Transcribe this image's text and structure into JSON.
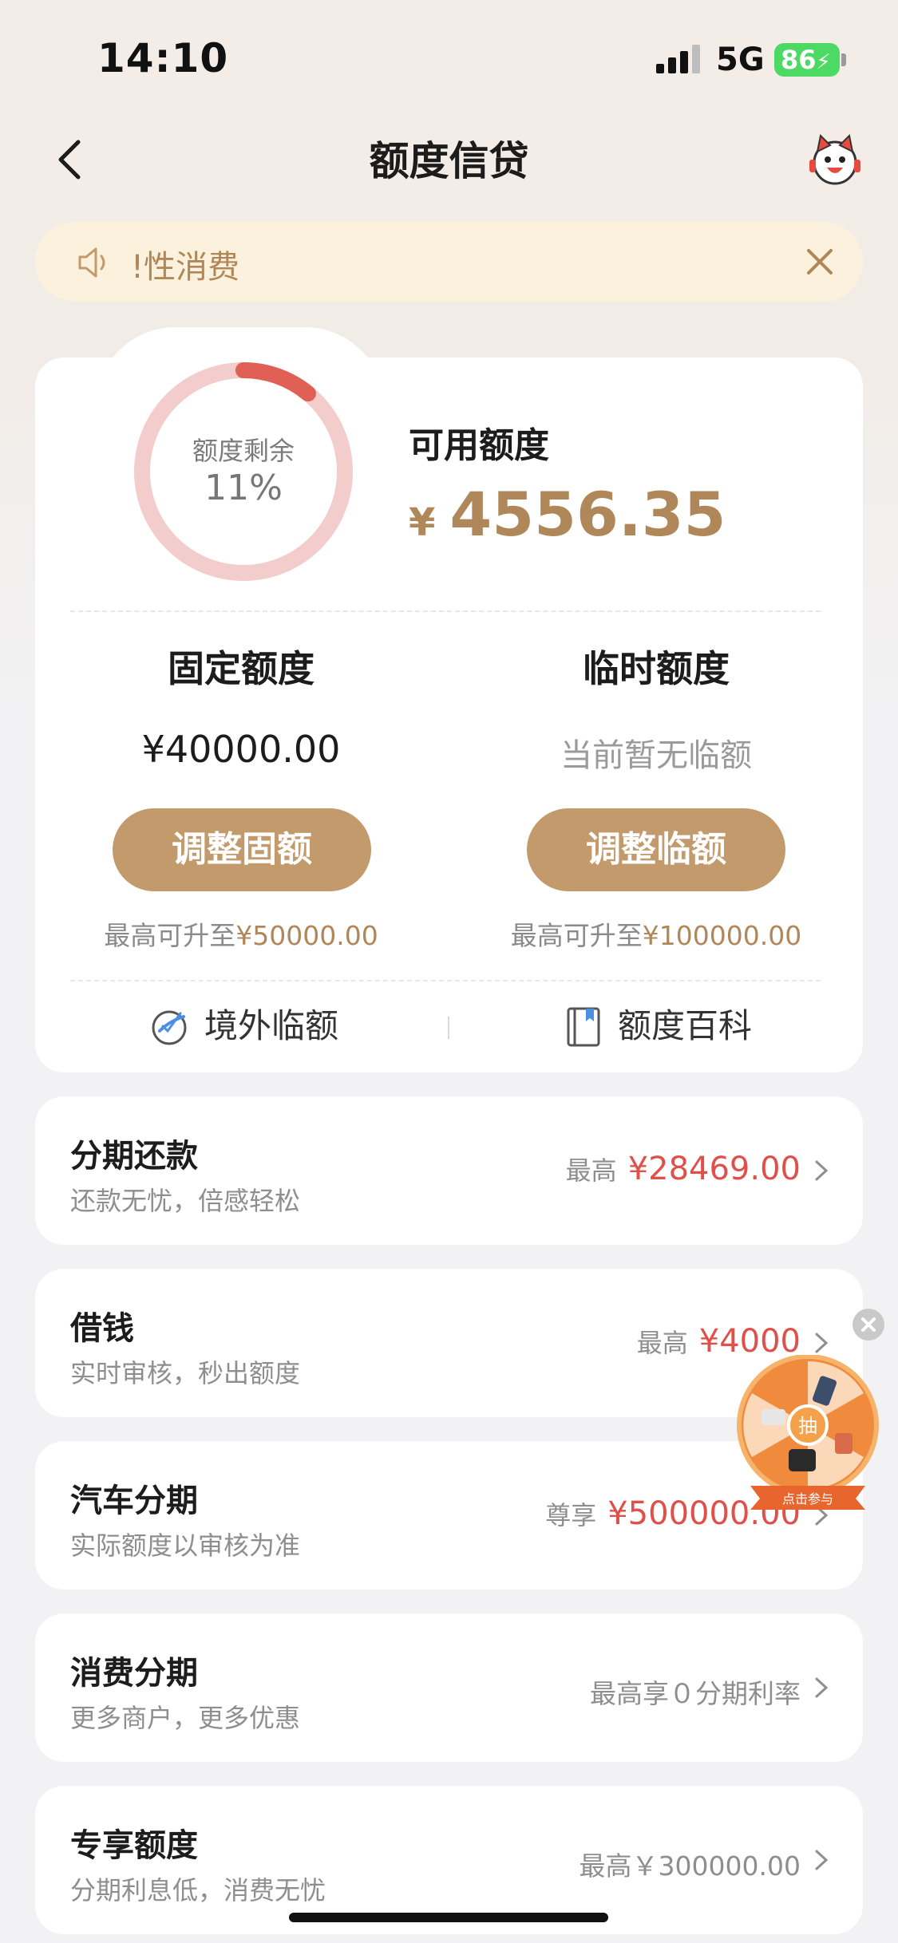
{
  "status": {
    "time": "14:10",
    "network": "5G",
    "battery": "86"
  },
  "nav": {
    "title": "额度信贷",
    "back_icon": "chevron-left-icon",
    "service_icon": "mascot-service-icon"
  },
  "notice": {
    "text": "!性消费",
    "icon": "speaker-icon",
    "close_icon": "close-icon"
  },
  "quota": {
    "ring_label": "额度剩余",
    "ring_percent": "11%",
    "ring_fraction": 0.11,
    "available_label": "可用额度",
    "available_currency": "¥",
    "available_amount": "4556.35",
    "fixed": {
      "title": "固定额度",
      "value": "¥40000.00",
      "button": "调整固额",
      "hint_prefix": "最高可升至",
      "hint_amount": "¥50000.00"
    },
    "temporary": {
      "title": "临时额度",
      "value": "当前暂无临额",
      "button": "调整临额",
      "hint_prefix": "最高可升至",
      "hint_amount": "¥100000.00"
    },
    "tools": [
      {
        "label": "境外临额",
        "icon": "overseas-icon"
      },
      {
        "label": "额度百科",
        "icon": "book-icon"
      }
    ]
  },
  "rows": [
    {
      "title": "分期还款",
      "subtitle": "还款无忧，倍感轻松",
      "prefix": "最高",
      "amount": "¥28469.00"
    },
    {
      "title": "借钱",
      "subtitle": "实时审核，秒出额度",
      "prefix": "最高",
      "amount": "¥4000"
    },
    {
      "title": "汽车分期",
      "subtitle": "实际额度以审核为准",
      "prefix": "尊享",
      "amount": "¥500000.00"
    },
    {
      "title": "消费分期",
      "subtitle": "更多商户，更多优惠",
      "plain": "最高享０分期利率"
    },
    {
      "title": "专享额度",
      "subtitle": "分期利息低，消费无忧",
      "plain": "最高￥300000.00"
    }
  ],
  "float_wheel": {
    "center_label": "抽",
    "ribbon_label": "点击参与"
  },
  "colors": {
    "gold": "#b08758",
    "button_gold": "#c29a6b",
    "red": "#e0504a",
    "ring_track": "#f3cdcc",
    "ring_fill": "#e06055"
  }
}
